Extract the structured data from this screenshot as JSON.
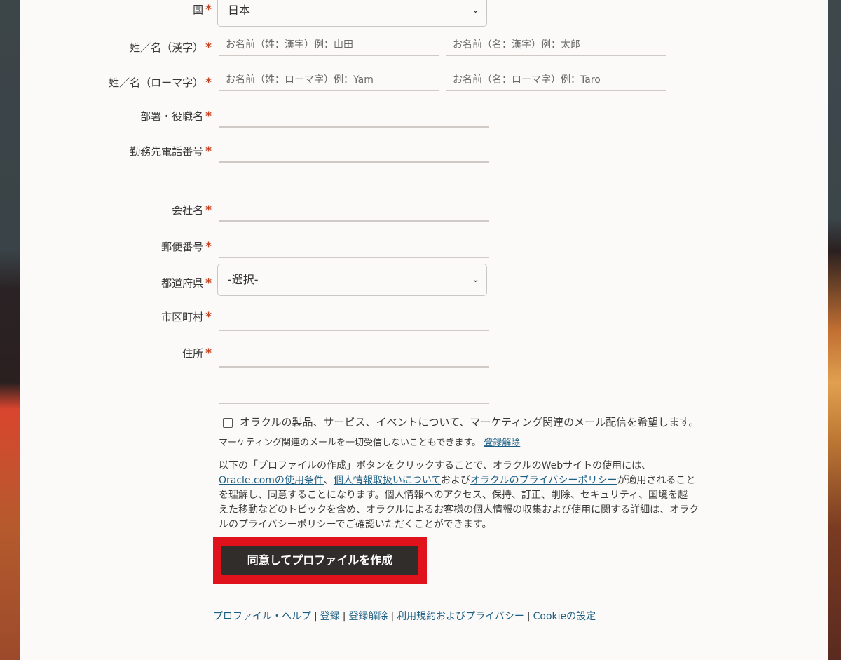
{
  "form": {
    "required_mark": "*",
    "country": {
      "label": "国",
      "value": "日本"
    },
    "name_kanji": {
      "label": "姓／名（漢字）",
      "last_placeholder": "お名前（姓：漢字）例：山田",
      "first_placeholder": "お名前（名：漢字）例：太郎"
    },
    "name_roman": {
      "label": "姓／名（ローマ字）",
      "last_placeholder": "お名前（姓：ローマ字）例：Yam",
      "first_placeholder": "お名前（名：ローマ字）例：Taro"
    },
    "department": {
      "label": "部署・役職名"
    },
    "phone": {
      "label": "勤務先電話番号"
    },
    "company": {
      "label": "会社名"
    },
    "postal": {
      "label": "郵便番号"
    },
    "prefecture": {
      "label": "都道府県",
      "value": "-選択-"
    },
    "city": {
      "label": "市区町村"
    },
    "address": {
      "label": "住所"
    }
  },
  "consent": {
    "checkbox_label": "オラクルの製品、サービス、イベントについて、マーケティング関連のメール配信を希望します。",
    "unsubscribe_note": "マーケティング関連のメールを一切受信しないこともできます。",
    "unsubscribe_link": "登録解除",
    "terms_line1": "以下の「プロファイルの作成」ボタンをクリックすることで、オラクルのWebサイトの使用には、",
    "terms_link1": "Oracle.comの使用条件",
    "terms_sep1": "、",
    "terms_link2": "個人情報取扱いについて",
    "terms_mid": "および",
    "terms_link3": "オラクルのプライバシーポリシー",
    "terms_line2_tail": "が適用されること",
    "terms_line3": "を理解し、同意することになります。個人情報へのアクセス、保持、訂正、削除、セキュリティ、国境を越",
    "terms_line4": "えた移動などのトピックを含め、オラクルによるお客様の個人情報の収集および使用に関する詳細は、オラク",
    "terms_line5": "ルのプライバシーポリシーでご確認いただくことができます。"
  },
  "submit_button": "同意してプロファイルを作成",
  "footer": {
    "links": [
      "プロファイル・ヘルプ",
      "登録",
      "登録解除",
      "利用規約およびプライバシー",
      "Cookieの設定"
    ],
    "separator": "|"
  },
  "colors": {
    "required": "#c9421f",
    "link": "#1a5e83",
    "button": "#312d2a",
    "highlight": "#e0121c"
  }
}
